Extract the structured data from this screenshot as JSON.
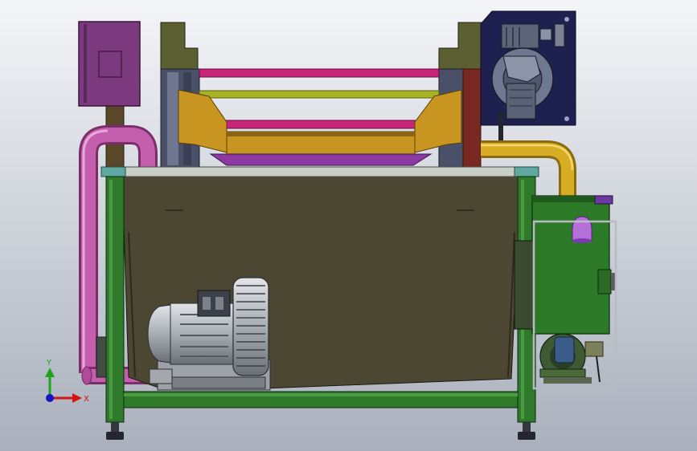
{
  "viewport": {
    "background_top": "#f4f5f8",
    "background_bottom": "#a9b0bc"
  },
  "triad": {
    "y_label": "Y",
    "x_label": "X",
    "y_color": "#1fa41f",
    "x_color": "#d11414",
    "z_color": "#1414c8"
  },
  "colors": {
    "frame_green": "#2f7a2a",
    "frame_dark": "#1a3d16",
    "tank_olive": "#4c4732",
    "top_slab": "#c9cfc6",
    "magenta_pipe": "#c35fad",
    "magenta_dark": "#7a2f6a",
    "rail_magenta": "#c8257a",
    "rail_yellow_green": "#a8b424",
    "hopper_orange": "#c89620",
    "hopper_dark": "#8a6414",
    "purple_box": "#7c3a7e",
    "purple_base": "#8c3aa0",
    "navy_panel": "#1e2050",
    "gearbox_grey": "#5c6578",
    "yellow_pipe": "#d6ad24",
    "blower_grey": "#b9bcc2",
    "steel_dark": "#3c4048",
    "olive_side": "#5b5f32",
    "brown_post": "#5a4628",
    "violet_light": "#b56fd8"
  }
}
